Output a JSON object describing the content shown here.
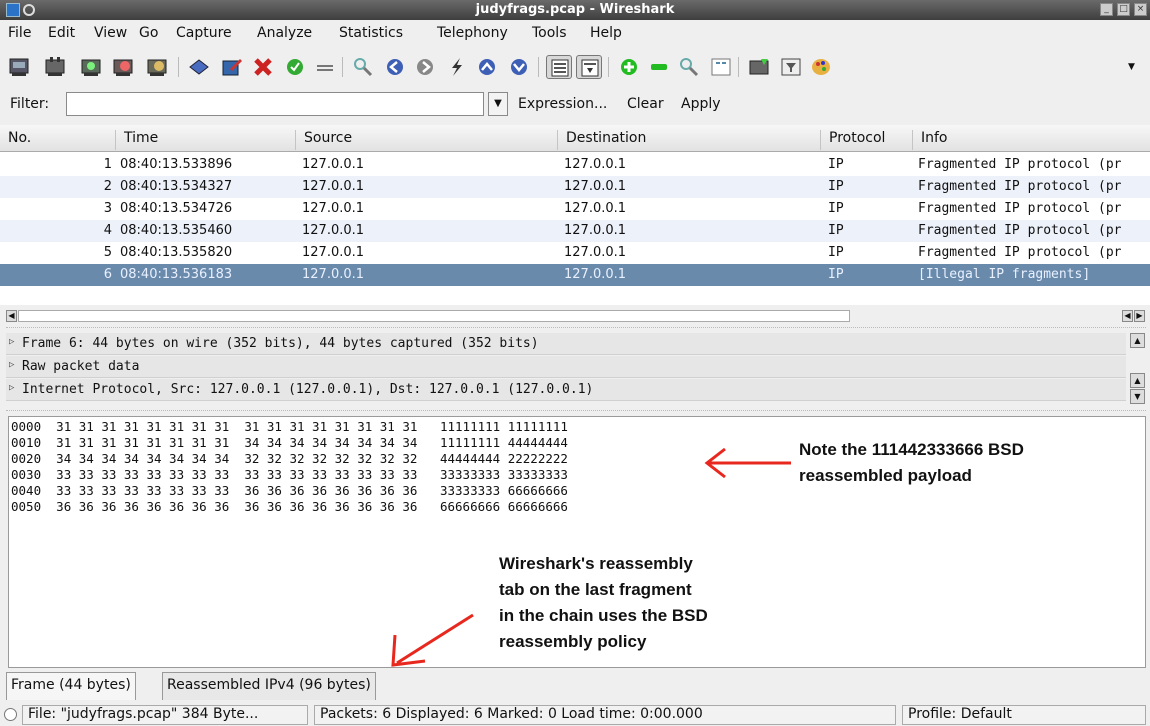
{
  "window": {
    "title": "judyfrags.pcap - Wireshark"
  },
  "menu": [
    "File",
    "Edit",
    "View",
    "Go",
    "Capture",
    "Analyze",
    "Statistics",
    "Telephony",
    "Tools",
    "Help"
  ],
  "filter": {
    "label": "Filter:",
    "value": "",
    "expression": "Expression...",
    "clear": "Clear",
    "apply": "Apply"
  },
  "packet_list": {
    "columns": [
      "No.",
      "Time",
      "Source",
      "Destination",
      "Protocol",
      "Info"
    ],
    "rows": [
      {
        "no": "1",
        "time": "08:40:13.533896",
        "src": "127.0.0.1",
        "dst": "127.0.0.1",
        "proto": "IP",
        "info": "Fragmented IP protocol (pr"
      },
      {
        "no": "2",
        "time": "08:40:13.534327",
        "src": "127.0.0.1",
        "dst": "127.0.0.1",
        "proto": "IP",
        "info": "Fragmented IP protocol (pr"
      },
      {
        "no": "3",
        "time": "08:40:13.534726",
        "src": "127.0.0.1",
        "dst": "127.0.0.1",
        "proto": "IP",
        "info": "Fragmented IP protocol (pr"
      },
      {
        "no": "4",
        "time": "08:40:13.535460",
        "src": "127.0.0.1",
        "dst": "127.0.0.1",
        "proto": "IP",
        "info": "Fragmented IP protocol (pr"
      },
      {
        "no": "5",
        "time": "08:40:13.535820",
        "src": "127.0.0.1",
        "dst": "127.0.0.1",
        "proto": "IP",
        "info": "Fragmented IP protocol (pr"
      },
      {
        "no": "6",
        "time": "08:40:13.536183",
        "src": "127.0.0.1",
        "dst": "127.0.0.1",
        "proto": "IP",
        "info": "[Illegal IP fragments]"
      }
    ]
  },
  "details": [
    "Frame 6: 44 bytes on wire (352 bits), 44 bytes captured (352 bits)",
    "Raw packet data",
    "Internet Protocol, Src: 127.0.0.1 (127.0.0.1), Dst: 127.0.0.1 (127.0.0.1)"
  ],
  "hex": [
    {
      "off": "0000",
      "hex": "31 31 31 31 31 31 31 31  31 31 31 31 31 31 31 31",
      "ascii": "11111111 11111111"
    },
    {
      "off": "0010",
      "hex": "31 31 31 31 31 31 31 31  34 34 34 34 34 34 34 34",
      "ascii": "11111111 44444444"
    },
    {
      "off": "0020",
      "hex": "34 34 34 34 34 34 34 34  32 32 32 32 32 32 32 32",
      "ascii": "44444444 22222222"
    },
    {
      "off": "0030",
      "hex": "33 33 33 33 33 33 33 33  33 33 33 33 33 33 33 33",
      "ascii": "33333333 33333333"
    },
    {
      "off": "0040",
      "hex": "33 33 33 33 33 33 33 33  36 36 36 36 36 36 36 36",
      "ascii": "33333333 66666666"
    },
    {
      "off": "0050",
      "hex": "36 36 36 36 36 36 36 36  36 36 36 36 36 36 36 36",
      "ascii": "66666666 66666666"
    }
  ],
  "annotations": {
    "note1": [
      "Note the 111442333666 BSD",
      "reassembled payload"
    ],
    "note2": [
      "Wireshark's reassembly",
      "tab on the last fragment",
      "in the chain uses the BSD",
      "reassembly policy"
    ],
    "arrow_color": "#e8281e"
  },
  "tabs": [
    "Frame (44 bytes)",
    "Reassembled IPv4 (96 bytes)"
  ],
  "status": {
    "file": "File: \"judyfrags.pcap\" 384 Byte...",
    "packets": "Packets: 6 Displayed: 6 Marked: 0 Load time: 0:00.000",
    "profile": "Profile: Default"
  },
  "colors": {
    "selected_row": "#6a8aac",
    "alt_row": "#edf1fa"
  }
}
